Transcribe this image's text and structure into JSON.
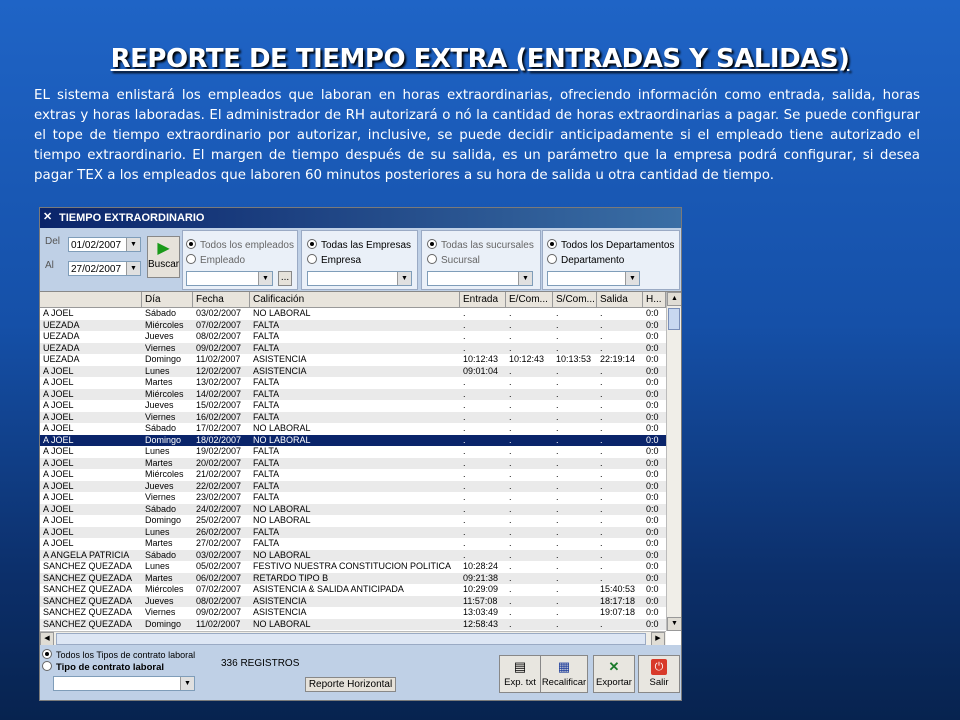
{
  "slide": {
    "title": "REPORTE DE TIEMPO EXTRA (ENTRADAS Y SALIDAS)",
    "description": "EL sistema enlistará los empleados que laboran en horas extraordinarias, ofreciendo información como entrada, salida, horas extras y horas laboradas. El administrador de RH autorizará o nó la cantidad de horas extraordinarias a pagar.  Se puede configurar el tope de tiempo extraordinario por autorizar, inclusive, se puede decidir anticipadamente si el empleado tiene autorizado el tiempo extraordinario.  El margen de tiempo después de su salida, es un parámetro que la empresa podrá configurar, si desea pagar TEX a los empleados que laboren 60 minutos posteriores a su hora de salida u otra cantidad de tiempo."
  },
  "window": {
    "title": "TIEMPO EXTRAORDINARIO",
    "icon": "tools-icon"
  },
  "filters": {
    "del_label": "Del",
    "al_label": "Al",
    "date_from": "01/02/2007",
    "date_to": "27/02/2007",
    "buscar_label": "Buscar",
    "employees": {
      "all": "Todos los empleados",
      "one": "Empleado",
      "more_button": "..."
    },
    "companies": {
      "all": "Todas las Empresas",
      "one": "Empresa"
    },
    "branches": {
      "all": "Todas las sucursales",
      "one": "Sucursal"
    },
    "departments": {
      "all": "Todos los Departamentos",
      "one": "Departamento"
    }
  },
  "grid": {
    "columns": [
      "",
      "Día",
      "Fecha",
      "Calificación",
      "Entrada",
      "E/Com...",
      "S/Com...",
      "Salida",
      "H..."
    ],
    "rows": [
      [
        "A JOEL",
        "Sábado",
        "03/02/2007",
        "NO LABORAL",
        ".",
        ".",
        ".",
        ".",
        "0:0"
      ],
      [
        "UEZADA",
        "Miércoles",
        "07/02/2007",
        "FALTA",
        ".",
        ".",
        ".",
        ".",
        "0:0"
      ],
      [
        "UEZADA",
        "Jueves",
        "08/02/2007",
        "FALTA",
        ".",
        ".",
        ".",
        ".",
        "0:0"
      ],
      [
        "UEZADA",
        "Viernes",
        "09/02/2007",
        "FALTA",
        ".",
        ".",
        ".",
        ".",
        "0:0"
      ],
      [
        "UEZADA",
        "Domingo",
        "11/02/2007",
        "ASISTENCIA",
        "10:12:43",
        "10:12:43",
        "10:13:53",
        "22:19:14",
        "0:0"
      ],
      [
        "A JOEL",
        "Lunes",
        "12/02/2007",
        "ASISTENCIA",
        "09:01:04",
        ".",
        ".",
        ".",
        "0:0"
      ],
      [
        "A JOEL",
        "Martes",
        "13/02/2007",
        "FALTA",
        ".",
        ".",
        ".",
        ".",
        "0:0"
      ],
      [
        "A JOEL",
        "Miércoles",
        "14/02/2007",
        "FALTA",
        ".",
        ".",
        ".",
        ".",
        "0:0"
      ],
      [
        "A JOEL",
        "Jueves",
        "15/02/2007",
        "FALTA",
        ".",
        ".",
        ".",
        ".",
        "0:0"
      ],
      [
        "A JOEL",
        "Viernes",
        "16/02/2007",
        "FALTA",
        ".",
        ".",
        ".",
        ".",
        "0:0"
      ],
      [
        "A JOEL",
        "Sábado",
        "17/02/2007",
        "NO LABORAL",
        ".",
        ".",
        ".",
        ".",
        "0:0"
      ],
      [
        "A JOEL",
        "Domingo",
        "18/02/2007",
        "NO LABORAL",
        ".",
        ".",
        ".",
        ".",
        "0:0"
      ],
      [
        "A JOEL",
        "Lunes",
        "19/02/2007",
        "FALTA",
        ".",
        ".",
        ".",
        ".",
        "0:0"
      ],
      [
        "A JOEL",
        "Martes",
        "20/02/2007",
        "FALTA",
        ".",
        ".",
        ".",
        ".",
        "0:0"
      ],
      [
        "A JOEL",
        "Miércoles",
        "21/02/2007",
        "FALTA",
        ".",
        ".",
        ".",
        ".",
        "0:0"
      ],
      [
        "A JOEL",
        "Jueves",
        "22/02/2007",
        "FALTA",
        ".",
        ".",
        ".",
        ".",
        "0:0"
      ],
      [
        "A JOEL",
        "Viernes",
        "23/02/2007",
        "FALTA",
        ".",
        ".",
        ".",
        ".",
        "0:0"
      ],
      [
        "A JOEL",
        "Sábado",
        "24/02/2007",
        "NO LABORAL",
        ".",
        ".",
        ".",
        ".",
        "0:0"
      ],
      [
        "A JOEL",
        "Domingo",
        "25/02/2007",
        "NO LABORAL",
        ".",
        ".",
        ".",
        ".",
        "0:0"
      ],
      [
        "A JOEL",
        "Lunes",
        "26/02/2007",
        "FALTA",
        ".",
        ".",
        ".",
        ".",
        "0:0"
      ],
      [
        "A JOEL",
        "Martes",
        "27/02/2007",
        "FALTA",
        ".",
        ".",
        ".",
        ".",
        "0:0"
      ],
      [
        "A ANGELA PATRICIA",
        "Sábado",
        "03/02/2007",
        "NO LABORAL",
        ".",
        ".",
        ".",
        ".",
        "0:0"
      ],
      [
        "SANCHEZ QUEZADA",
        "Lunes",
        "05/02/2007",
        "FESTIVO  NUESTRA CONSTITUCION POLITICA",
        "10:28:24",
        ".",
        ".",
        ".",
        "0:0"
      ],
      [
        "SANCHEZ QUEZADA",
        "Martes",
        "06/02/2007",
        "RETARDO TIPO B",
        "09:21:38",
        ".",
        ".",
        ".",
        "0:0"
      ],
      [
        "SANCHEZ QUEZADA",
        "Miércoles",
        "07/02/2007",
        "ASISTENCIA & SALIDA ANTICIPADA",
        "10:29:09",
        ".",
        ".",
        "15:40:53",
        "0:0"
      ],
      [
        "SANCHEZ QUEZADA",
        "Jueves",
        "08/02/2007",
        "ASISTENCIA",
        "11:57:08",
        ".",
        ".",
        "18:17:18",
        "0:0"
      ],
      [
        "SANCHEZ QUEZADA",
        "Viernes",
        "09/02/2007",
        "ASISTENCIA",
        "13:03:49",
        ".",
        ".",
        "19:07:18",
        "0:0"
      ],
      [
        "SANCHEZ QUEZADA",
        "Domingo",
        "11/02/2007",
        "NO LABORAL",
        "12:58:43",
        ".",
        ".",
        ".",
        "0:0"
      ]
    ],
    "selected_row": 11
  },
  "footer": {
    "contract_all": "Todos los Tipos de contrato laboral",
    "contract_one": "Tipo de contrato laboral",
    "records": "336 REGISTROS",
    "report_button": "Reporte Horizontal",
    "buttons": [
      {
        "label": "Exp. txt",
        "icon": "notepad-icon"
      },
      {
        "label": "Recalificar",
        "icon": "calendar-grid-icon"
      },
      {
        "label": "Exportar",
        "icon": "excel-icon"
      },
      {
        "label": "Salir",
        "icon": "exit-icon"
      }
    ]
  }
}
